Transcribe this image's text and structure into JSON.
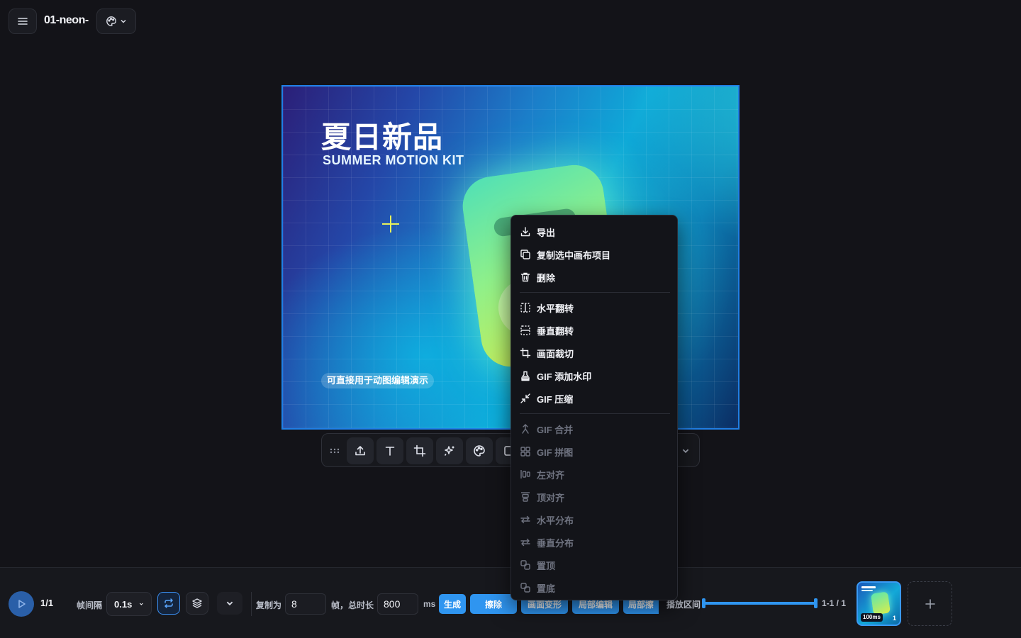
{
  "header": {
    "file_name": "01-neon-",
    "menu_icon": "hamburger-icon",
    "theme_icon": "palette-icon"
  },
  "canvas": {
    "title": "夏日新品",
    "subtitle": "SUMMER MOTION KIT",
    "caption": "可直接用于动图编辑演示"
  },
  "toolbar": {
    "tools": [
      "grip-icon",
      "upload-icon",
      "text-icon",
      "crop-icon",
      "sparkle-icon",
      "palette-icon",
      "resize-icon",
      "chevron-down-icon"
    ]
  },
  "context_menu": {
    "items": [
      {
        "label": "导出",
        "icon": "download-icon",
        "enabled": true
      },
      {
        "label": "复制选中画布项目",
        "icon": "copy-icon",
        "enabled": true
      },
      {
        "label": "删除",
        "icon": "trash-icon",
        "enabled": true
      },
      {
        "label": "水平翻转",
        "icon": "flip-horizontal-icon",
        "enabled": true
      },
      {
        "label": "垂直翻转",
        "icon": "flip-vertical-icon",
        "enabled": true
      },
      {
        "label": "画面裁切",
        "icon": "crop-icon",
        "enabled": true
      },
      {
        "label": "GIF 添加水印",
        "icon": "stamp-icon",
        "enabled": true
      },
      {
        "label": "GIF 压缩",
        "icon": "shrink-icon",
        "enabled": true
      },
      {
        "label": "GIF 合并",
        "icon": "merge-icon",
        "enabled": false
      },
      {
        "label": "GIF 拼图",
        "icon": "grid-icon",
        "enabled": false
      },
      {
        "label": "左对齐",
        "icon": "align-left-icon",
        "enabled": false
      },
      {
        "label": "顶对齐",
        "icon": "align-top-icon",
        "enabled": false
      },
      {
        "label": "水平分布",
        "icon": "distribute-horizontal-icon",
        "enabled": false
      },
      {
        "label": "垂直分布",
        "icon": "distribute-vertical-icon",
        "enabled": false
      },
      {
        "label": "置顶",
        "icon": "bring-front-icon",
        "enabled": false
      },
      {
        "label": "置底",
        "icon": "send-back-icon",
        "enabled": false
      }
    ]
  },
  "bottom": {
    "frame_counter": "1/1",
    "interval_label": "帧间隔",
    "interval_value": "0.1s",
    "copy_label": "复制为",
    "copy_value": "8",
    "total_label": "帧，总时长",
    "total_value": "800",
    "ms_label": "ms",
    "generate_label": "生成",
    "erase_label": "擦除",
    "hidden_btn_1": "画面变形",
    "hidden_btn_2": "局部编辑",
    "hidden_btn_3": "局部擦",
    "range_label": "播放区间",
    "range_value": "1-1 / 1",
    "thumb_duration": "100ms",
    "thumb_index": "1",
    "accent": "#2f95f0"
  }
}
